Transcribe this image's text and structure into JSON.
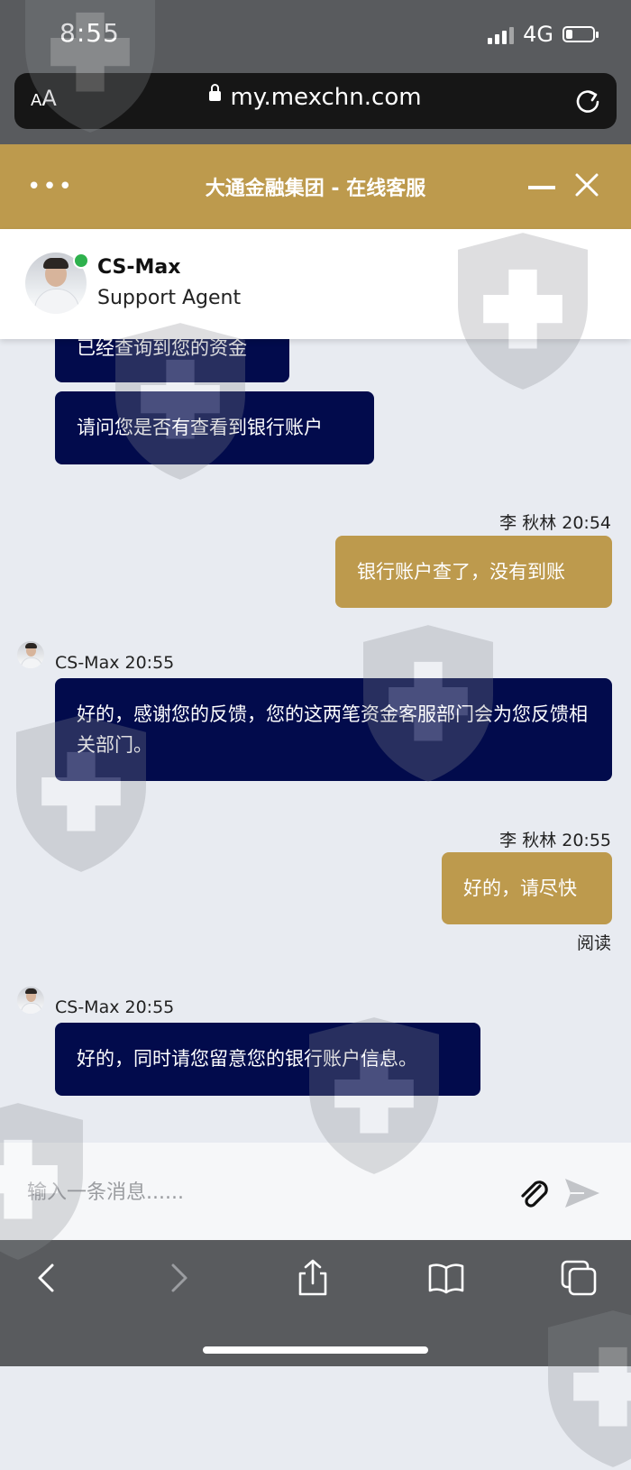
{
  "status_bar": {
    "time": "8:55",
    "network": "4G",
    "battery_level": 0.25
  },
  "browser": {
    "text_size_label_small": "A",
    "text_size_label_large": "A",
    "url": "my.mexchn.com"
  },
  "chat_header": {
    "menu": "•••",
    "title": "大通金融集团 - 在线客服"
  },
  "agent": {
    "name": "CS-Max",
    "role": "Support Agent",
    "status": "online"
  },
  "messages": [
    {
      "text": "已经查询到您的资金"
    },
    {
      "text": "请问您是否有查看到银行账户"
    },
    {
      "meta": "李 秋林 20:54",
      "text": "银行账户查了，没有到账"
    },
    {
      "meta": "CS-Max 20:55",
      "text": "好的，感谢您的反馈，您的这两笔资金客服部门会为您反馈相关部门。"
    },
    {
      "meta": "李 秋林 20:55",
      "text": "好的，请尽快",
      "receipt": "阅读"
    },
    {
      "meta": "CS-Max 20:55",
      "text": "好的，同时请您留意您的银行账户信息。"
    }
  ],
  "input": {
    "placeholder": "输入一条消息......",
    "value": ""
  },
  "colors": {
    "gold": "#bd9a4d",
    "navy": "#020b4c",
    "online": "#2eb14d"
  },
  "icons": [
    "reload-icon",
    "close-icon",
    "minimize-icon",
    "attach-icon",
    "send-icon",
    "back-icon",
    "forward-icon",
    "share-icon",
    "bookmarks-icon",
    "tabs-icon"
  ]
}
